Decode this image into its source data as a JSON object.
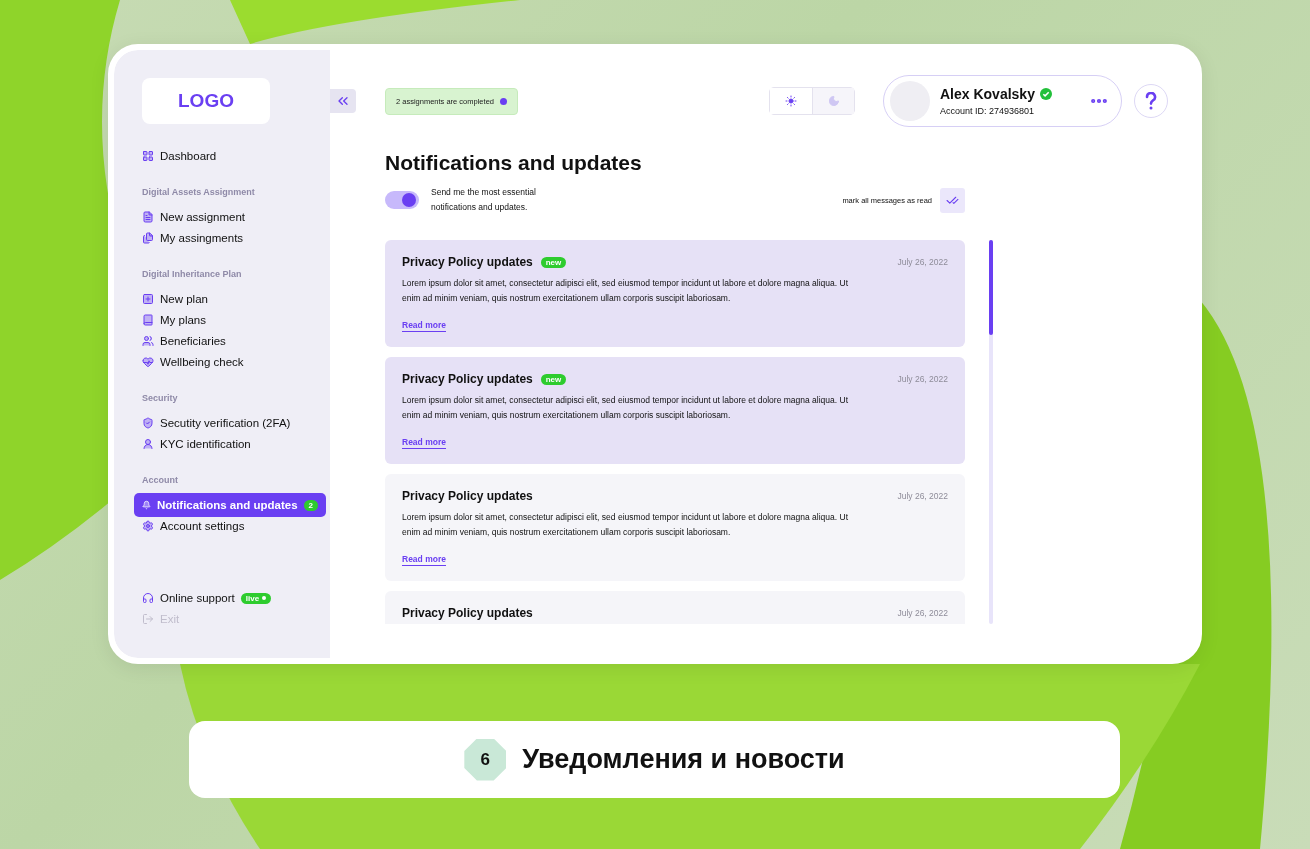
{
  "sidebar": {
    "logo": "LOGO",
    "sections": [
      {
        "items": [
          {
            "label": "Dashboard",
            "selected": false
          }
        ]
      },
      {
        "heading": "Digital Assets Assignment",
        "items": [
          {
            "label": "New assignment",
            "selected": false
          },
          {
            "label": "My assingments",
            "selected": false
          }
        ]
      },
      {
        "heading": "Digital Inheritance Plan",
        "items": [
          {
            "label": "New plan",
            "selected": false
          },
          {
            "label": "My plans",
            "selected": false
          },
          {
            "label": "Beneficiaries",
            "selected": false
          },
          {
            "label": "Wellbeing check",
            "selected": false
          }
        ]
      },
      {
        "heading": "Security",
        "items": [
          {
            "label": "Secutity verification (2FA)",
            "selected": false
          },
          {
            "label": "KYC identification",
            "selected": false
          }
        ]
      },
      {
        "heading": "Account",
        "items": [
          {
            "label": "Notifications and updates",
            "selected": true,
            "badge": "2"
          },
          {
            "label": "Account settings",
            "selected": false
          }
        ]
      }
    ],
    "bottom_items": [
      {
        "label": "Online support",
        "badge": "live",
        "disabled": false
      },
      {
        "label": "Exit",
        "disabled": true
      }
    ]
  },
  "header": {
    "banner": "2 assignments are completed",
    "theme_options": [
      {
        "kind": "sun",
        "selected": true
      },
      {
        "kind": "moon",
        "selected": false
      }
    ],
    "profile": {
      "name": "Alex Kovalsky",
      "verified": true,
      "account_id": "Account ID: 274936801"
    }
  },
  "page": {
    "title": "Notifications and updates",
    "toggle": {
      "label": "Send me the most essential notifications and updates.",
      "on": true
    },
    "mark_all": "mark all messages as read"
  },
  "notifications": [
    {
      "title": "Privacy Policy updates",
      "unread": true,
      "badge": "new",
      "date": "July 26, 2022",
      "text": "Lorem ipsum dolor sit amet, consectetur adipisci elit, sed eiusmod tempor incidunt ut labore et dolore magna aliqua. Ut enim ad minim veniam, quis nostrum exercitationem ullam corporis suscipit laboriosam.",
      "link": "Read more"
    },
    {
      "title": "Privacy Policy updates",
      "unread": true,
      "badge": "new",
      "date": "July 26, 2022",
      "text": "Lorem ipsum dolor sit amet, consectetur adipisci elit, sed eiusmod tempor incidunt ut labore et dolore magna aliqua. Ut enim ad minim veniam, quis nostrum exercitationem ullam corporis suscipit laboriosam.",
      "link": "Read more"
    },
    {
      "title": "Privacy Policy updates",
      "unread": false,
      "date": "July 26, 2022",
      "text": "Lorem ipsum dolor sit amet, consectetur adipisci elit, sed eiusmod tempor incidunt ut labore et dolore magna aliqua. Ut enim ad minim veniam, quis nostrum exercitationem ullam corporis suscipit laboriosam.",
      "link": "Read more"
    },
    {
      "title": "Privacy Policy updates",
      "unread": false,
      "date": "July 26, 2022"
    }
  ],
  "caption": {
    "number": "6",
    "title": "Уведомления и новости"
  }
}
